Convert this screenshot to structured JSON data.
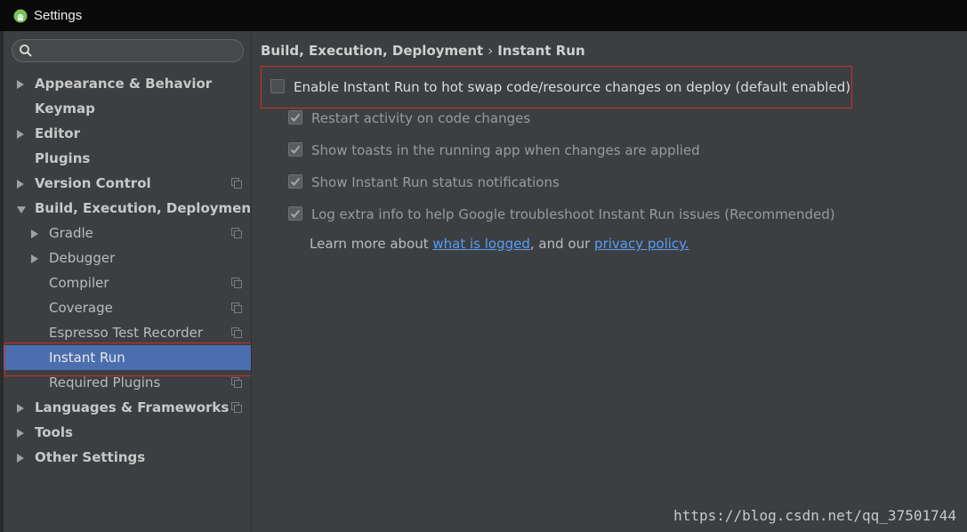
{
  "window": {
    "title": "Settings",
    "app_icon": "android-icon"
  },
  "search": {
    "placeholder": "",
    "icon": "search-icon"
  },
  "sidebar": {
    "items": [
      {
        "label": "Appearance & Behavior",
        "level": 0,
        "arrow": "right",
        "copy": false
      },
      {
        "label": "Keymap",
        "level": 0,
        "arrow": "none",
        "copy": false
      },
      {
        "label": "Editor",
        "level": 0,
        "arrow": "right",
        "copy": false
      },
      {
        "label": "Plugins",
        "level": 0,
        "arrow": "none",
        "copy": false
      },
      {
        "label": "Version Control",
        "level": 0,
        "arrow": "right",
        "copy": true
      },
      {
        "label": "Build, Execution, Deployment",
        "level": 0,
        "arrow": "down",
        "copy": false
      },
      {
        "label": "Gradle",
        "level": 1,
        "arrow": "right",
        "copy": true
      },
      {
        "label": "Debugger",
        "level": 1,
        "arrow": "right",
        "copy": false
      },
      {
        "label": "Compiler",
        "level": 1,
        "arrow": "none",
        "copy": true
      },
      {
        "label": "Coverage",
        "level": 1,
        "arrow": "none",
        "copy": true
      },
      {
        "label": "Espresso Test Recorder",
        "level": 1,
        "arrow": "none",
        "copy": true
      },
      {
        "label": "Instant Run",
        "level": 1,
        "arrow": "none",
        "copy": false,
        "selected": true
      },
      {
        "label": "Required Plugins",
        "level": 1,
        "arrow": "none",
        "copy": true
      },
      {
        "label": "Languages & Frameworks",
        "level": 0,
        "arrow": "right",
        "copy": true
      },
      {
        "label": "Tools",
        "level": 0,
        "arrow": "right",
        "copy": false
      },
      {
        "label": "Other Settings",
        "level": 0,
        "arrow": "right",
        "copy": false
      }
    ]
  },
  "breadcrumb": {
    "parent": "Build, Execution, Deployment",
    "separator": "›",
    "current": "Instant Run"
  },
  "options": [
    {
      "label": "Enable Instant Run to hot swap code/resource changes on deploy (default enabled)",
      "checked": false,
      "enabled": true
    },
    {
      "label": "Restart activity on code changes",
      "checked": true,
      "enabled": false
    },
    {
      "label": "Show toasts in the running app when changes are applied",
      "checked": true,
      "enabled": false
    },
    {
      "label": "Show Instant Run status notifications",
      "checked": true,
      "enabled": false
    },
    {
      "label": "Log extra info to help Google troubleshoot Instant Run issues (Recommended)",
      "checked": true,
      "enabled": false
    }
  ],
  "learn_more": {
    "prefix": "Learn more about ",
    "link1": "what is logged",
    "middle": ", and our ",
    "link2": "privacy policy."
  },
  "watermark": "https://blog.csdn.net/qq_37501744",
  "colors": {
    "selection": "#4b6eaf",
    "highlight_border": "#d62b2b",
    "link": "#589df6",
    "background": "#3c3f41"
  }
}
